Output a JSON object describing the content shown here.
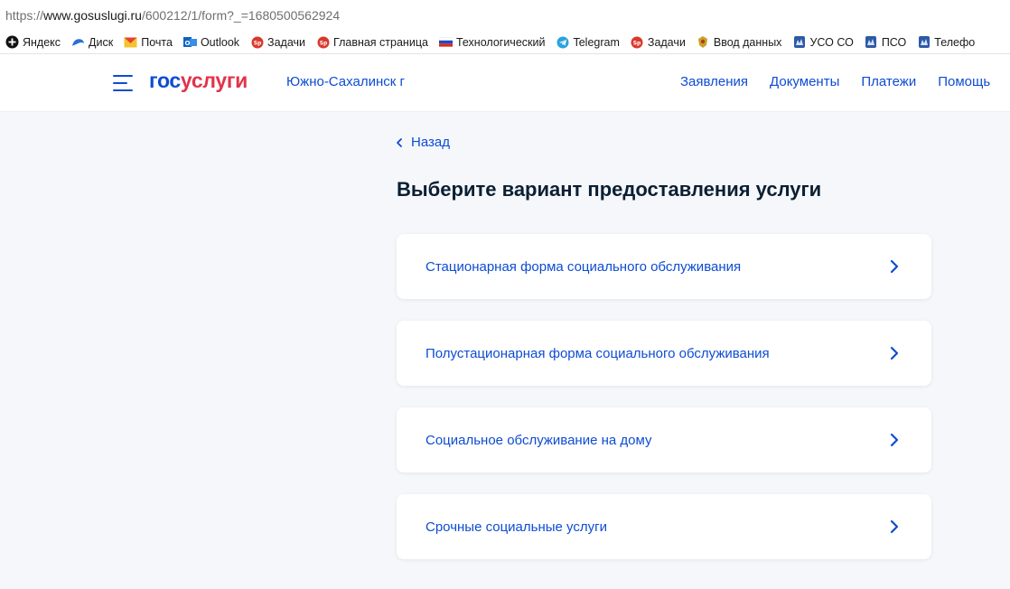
{
  "browser": {
    "url_scheme": "https://",
    "url_host": "www.gosuslugi.ru",
    "url_path": "/600212/1/form?_=1680500562924",
    "bookmarks": [
      {
        "label": "Яндекс",
        "icon": "yandex-icon"
      },
      {
        "label": "Диск",
        "icon": "disk-icon"
      },
      {
        "label": "Почта",
        "icon": "mail-icon"
      },
      {
        "label": "Outlook",
        "icon": "outlook-icon"
      },
      {
        "label": "Задачи",
        "icon": "tasks-icon"
      },
      {
        "label": "Главная страница",
        "icon": "tasks-icon"
      },
      {
        "label": "Технологический",
        "icon": "russia-flag-icon"
      },
      {
        "label": "Telegram",
        "icon": "telegram-icon"
      },
      {
        "label": "Задачи",
        "icon": "tasks-icon"
      },
      {
        "label": "Ввод данных",
        "icon": "emblem-icon"
      },
      {
        "label": "УСО СО",
        "icon": "sakhalin-emblem-icon"
      },
      {
        "label": "ПСО",
        "icon": "sakhalin-emblem-icon"
      },
      {
        "label": "Телефо",
        "icon": "sakhalin-emblem-icon"
      }
    ]
  },
  "header": {
    "logo_part1": "гос",
    "logo_part2": "услуги",
    "city": "Южно-Сахалинск г",
    "nav": [
      "Заявления",
      "Документы",
      "Платежи",
      "Помощь"
    ]
  },
  "main": {
    "back_label": "Назад",
    "title": "Выберите вариант предоставления услуги",
    "options": [
      "Стационарная форма социального обслуживания",
      "Полустационарная форма социального обслуживания",
      "Социальное обслуживание на дому",
      "Срочные социальные услуги"
    ]
  },
  "colors": {
    "accent": "#0d4cd3",
    "logo_red": "#e3324b",
    "text": "#0b1f33",
    "page_bg": "#f5f7fa"
  }
}
